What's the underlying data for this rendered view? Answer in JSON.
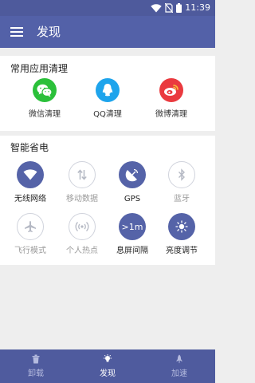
{
  "status_bar": {
    "time": "11:39",
    "icons": [
      "wifi-icon",
      "no-sim-icon",
      "battery-icon"
    ]
  },
  "app_bar": {
    "title": "发现",
    "menu_icon": "menu-icon"
  },
  "cleanup": {
    "title": "常用应用清理",
    "items": [
      {
        "label": "微信清理",
        "icon": "wechat-icon",
        "color": "#2bc03a"
      },
      {
        "label": "QQ清理",
        "icon": "qq-icon",
        "color": "#1ea4ec"
      },
      {
        "label": "微博清理",
        "icon": "weibo-icon",
        "color": "#ea3a3f"
      }
    ]
  },
  "power": {
    "title": "智能省电",
    "toggles": [
      {
        "label": "无线网络",
        "icon": "wifi-icon",
        "enabled": true
      },
      {
        "label": "移动数据",
        "icon": "mobile-data-icon",
        "enabled": false
      },
      {
        "label": "GPS",
        "icon": "gps-icon",
        "enabled": true
      },
      {
        "label": "蓝牙",
        "icon": "bluetooth-icon",
        "enabled": false
      },
      {
        "label": "飞行模式",
        "icon": "airplane-icon",
        "enabled": false
      },
      {
        "label": "个人热点",
        "icon": "hotspot-icon",
        "enabled": false
      },
      {
        "label": "息屏间隔",
        "icon": "screen-timeout-icon",
        "value": ">1m",
        "enabled": true
      },
      {
        "label": "亮度调节",
        "icon": "brightness-icon",
        "enabled": true
      }
    ]
  },
  "bottom_nav": {
    "items": [
      {
        "label": "卸载",
        "icon": "trash-icon",
        "active": false
      },
      {
        "label": "发现",
        "icon": "lightbulb-icon",
        "active": true
      },
      {
        "label": "加速",
        "icon": "rocket-icon",
        "active": false
      }
    ]
  },
  "colors": {
    "primary": "#5361a8",
    "status_bar": "#4e5a9c",
    "bottom_nav": "#4f5b9e",
    "toggle_on": "#5563a8",
    "toggle_off_border": "#d0d3dc",
    "background": "#eeeeee"
  }
}
